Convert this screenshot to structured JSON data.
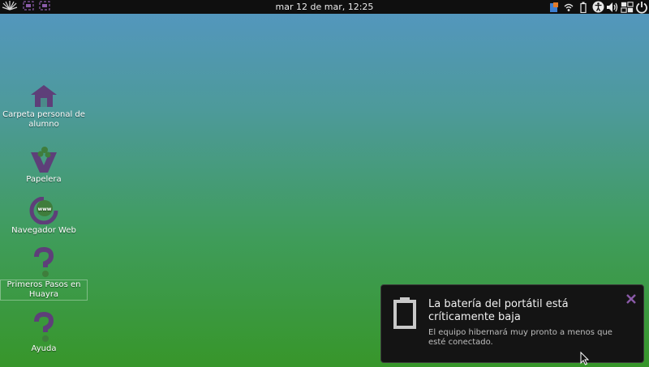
{
  "panel": {
    "clock": "mar 12 de mar, 12:25",
    "left_icons": [
      "huayra-logo-icon",
      "window-grid-icon",
      "window-grid-icon-2"
    ],
    "tray_icons": [
      "network-status-icon",
      "wifi-icon",
      "battery-icon",
      "accessibility-icon",
      "volume-icon",
      "keyboard-layout-icon",
      "power-icon"
    ]
  },
  "desktop": {
    "icons": [
      {
        "label": "Carpeta personal de alumno",
        "icon": "home-folder-icon"
      },
      {
        "label": "Papelera",
        "icon": "trash-icon"
      },
      {
        "label": "Navegador Web",
        "icon": "web-browser-icon"
      },
      {
        "label": "Primeros Pasos en Huayra",
        "icon": "help-icon"
      },
      {
        "label": "Ayuda",
        "icon": "help-icon"
      }
    ]
  },
  "notification": {
    "title": "La batería del portátil está críticamente baja",
    "body": "El equipo hibernará muy pronto a menos que esté conectado.",
    "icon": "battery-empty-icon"
  },
  "colors": {
    "icon_purple": "#5e3f79",
    "panel_bg": "#0f0f0f",
    "notify_bg": "#141414"
  }
}
